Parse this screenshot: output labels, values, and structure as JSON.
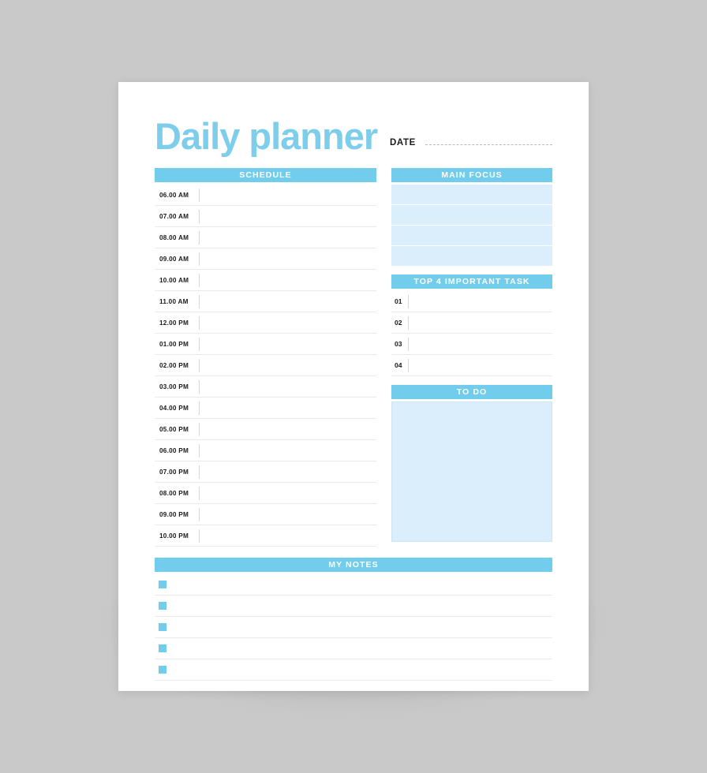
{
  "page": {
    "title": "Daily planner",
    "background_color": "#c9c9c9",
    "paper_color": "#ffffff",
    "accent_color": "#71cdeb",
    "accent_light_color": "#daeffb",
    "title_color": "#7ecdea"
  },
  "date": {
    "label": "DATE",
    "value": ""
  },
  "schedule": {
    "heading": "SCHEDULE",
    "rows": [
      {
        "time": "06.00 AM",
        "entry": ""
      },
      {
        "time": "07.00 AM",
        "entry": ""
      },
      {
        "time": "08.00 AM",
        "entry": ""
      },
      {
        "time": "09.00 AM",
        "entry": ""
      },
      {
        "time": "10.00 AM",
        "entry": ""
      },
      {
        "time": "11.00 AM",
        "entry": ""
      },
      {
        "time": "12.00 PM",
        "entry": ""
      },
      {
        "time": "01.00 PM",
        "entry": ""
      },
      {
        "time": "02.00 PM",
        "entry": ""
      },
      {
        "time": "03.00 PM",
        "entry": ""
      },
      {
        "time": "04.00 PM",
        "entry": ""
      },
      {
        "time": "05.00 PM",
        "entry": ""
      },
      {
        "time": "06.00 PM",
        "entry": ""
      },
      {
        "time": "07.00 PM",
        "entry": ""
      },
      {
        "time": "08.00 PM",
        "entry": ""
      },
      {
        "time": "09.00 PM",
        "entry": ""
      },
      {
        "time": "10.00 PM",
        "entry": ""
      }
    ]
  },
  "main_focus": {
    "heading": "MAIN FOCUS",
    "rows": [
      "",
      "",
      "",
      ""
    ]
  },
  "top_tasks": {
    "heading": "TOP 4 IMPORTANT TASK",
    "rows": [
      {
        "number": "01",
        "text": ""
      },
      {
        "number": "02",
        "text": ""
      },
      {
        "number": "03",
        "text": ""
      },
      {
        "number": "04",
        "text": ""
      }
    ]
  },
  "todo": {
    "heading": "TO DO",
    "content": ""
  },
  "notes": {
    "heading": "MY NOTES",
    "rows": [
      "",
      "",
      "",
      "",
      ""
    ]
  }
}
